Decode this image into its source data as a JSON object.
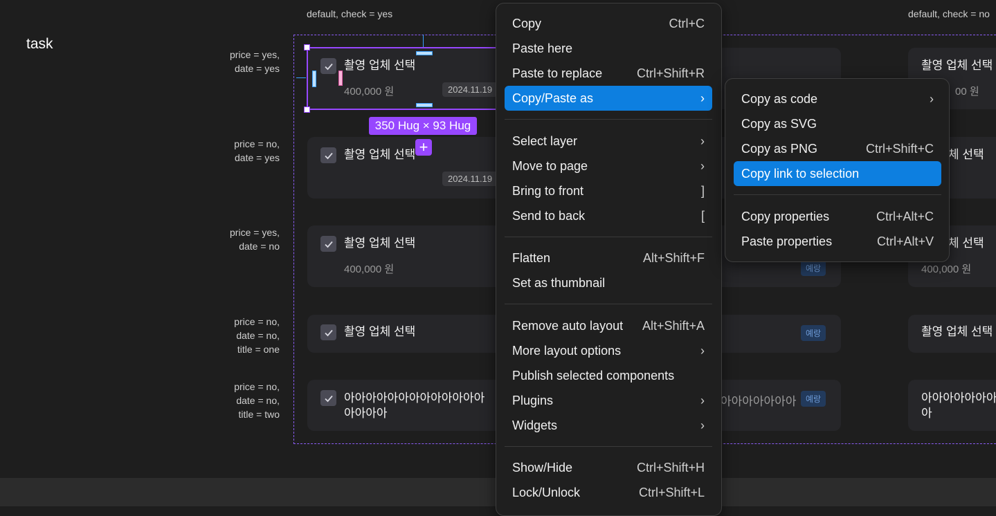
{
  "page_title": "task",
  "columns": [
    "default, check = yes",
    "default, check = no"
  ],
  "rows": [
    {
      "label": "price = yes,\ndate = yes"
    },
    {
      "label": "price = no,\ndate = yes"
    },
    {
      "label": "price = yes,\ndate = no"
    },
    {
      "label": "price = no,\ndate = no,\ntitle = one"
    },
    {
      "label": "price = no,\ndate = no,\ntitle = two"
    }
  ],
  "cards": {
    "c1": {
      "title": "촬영 업체 선택",
      "price": "400,000 원",
      "date": "2024.11.19"
    },
    "c2": {
      "title": "촬영 업체 선택",
      "date": "2024.11.19"
    },
    "c3": {
      "title": "촬영 업체 선택",
      "price": "400,000 원",
      "badge": "예랑"
    },
    "c4": {
      "title": "촬영 업체 선택",
      "badge": "예랑"
    },
    "c5": {
      "title": "아아아아아아아아아아아아아\n아아아아",
      "overflow": "아아아아아아아",
      "badge": "예랑"
    },
    "r1": {
      "title": "촬영 업체 선택",
      "price": "00 원"
    },
    "r2": {
      "title": "체 선택"
    },
    "r3": {
      "title": "체 선택",
      "price": "400,000 원"
    },
    "r4": {
      "title": "촬영 업체 선택"
    },
    "r5": {
      "title": "아아아아아아아\n아"
    }
  },
  "selection": {
    "size_label": "350 Hug × 93 Hug"
  },
  "context_menu": {
    "groups": [
      [
        {
          "label": "Copy",
          "shortcut": "Ctrl+C"
        },
        {
          "label": "Paste here",
          "shortcut": ""
        },
        {
          "label": "Paste to replace",
          "shortcut": "Ctrl+Shift+R"
        },
        {
          "label": "Copy/Paste as",
          "shortcut": "›",
          "active": true
        }
      ],
      [
        {
          "label": "Select layer",
          "shortcut": "›"
        },
        {
          "label": "Move to page",
          "shortcut": "›"
        },
        {
          "label": "Bring to front",
          "shortcut": "]"
        },
        {
          "label": "Send to back",
          "shortcut": "["
        }
      ],
      [
        {
          "label": "Flatten",
          "shortcut": "Alt+Shift+F"
        },
        {
          "label": "Set as thumbnail",
          "shortcut": ""
        }
      ],
      [
        {
          "label": "Remove auto layout",
          "shortcut": "Alt+Shift+A"
        },
        {
          "label": "More layout options",
          "shortcut": "›"
        },
        {
          "label": "Publish selected components",
          "shortcut": ""
        },
        {
          "label": "Plugins",
          "shortcut": "›"
        },
        {
          "label": "Widgets",
          "shortcut": "›"
        }
      ],
      [
        {
          "label": "Show/Hide",
          "shortcut": "Ctrl+Shift+H"
        },
        {
          "label": "Lock/Unlock",
          "shortcut": "Ctrl+Shift+L"
        }
      ]
    ]
  },
  "submenu": {
    "groups": [
      [
        {
          "label": "Copy as code",
          "shortcut": "›"
        },
        {
          "label": "Copy as SVG",
          "shortcut": ""
        },
        {
          "label": "Copy as PNG",
          "shortcut": "Ctrl+Shift+C"
        },
        {
          "label": "Copy link to selection",
          "shortcut": "",
          "active": true
        }
      ],
      [
        {
          "label": "Copy properties",
          "shortcut": "Ctrl+Alt+C"
        },
        {
          "label": "Paste properties",
          "shortcut": "Ctrl+Alt+V"
        }
      ]
    ]
  }
}
